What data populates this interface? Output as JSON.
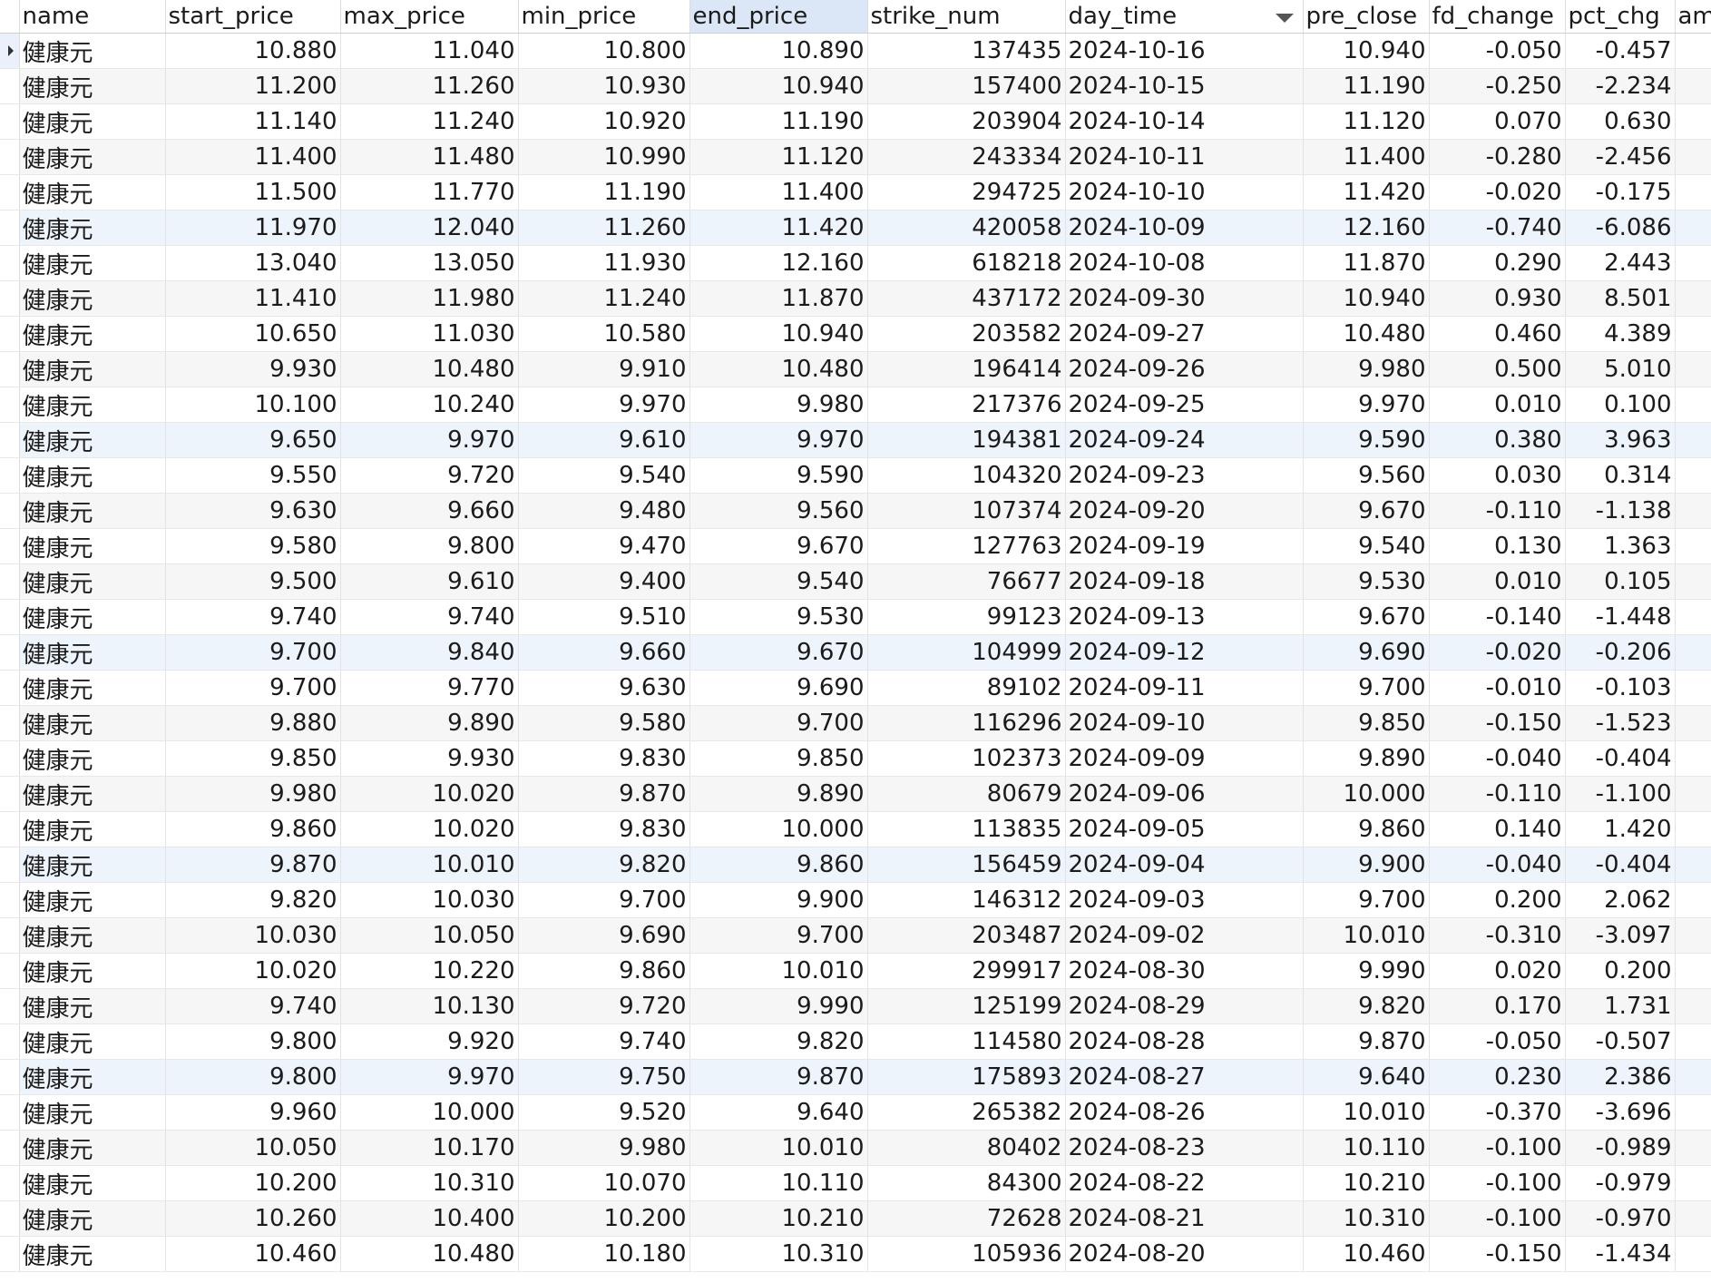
{
  "columns": [
    "name",
    "start_price",
    "max_price",
    "min_price",
    "end_price",
    "strike_num",
    "day_time",
    "pre_close",
    "fd_change",
    "pct_chg",
    "amo"
  ],
  "rows": [
    [
      "健康元",
      "10.880",
      "11.040",
      "10.800",
      "10.890",
      "137435",
      "2024-10-16",
      "10.940",
      "-0.050",
      "-0.457"
    ],
    [
      "健康元",
      "11.200",
      "11.260",
      "10.930",
      "10.940",
      "157400",
      "2024-10-15",
      "11.190",
      "-0.250",
      "-2.234"
    ],
    [
      "健康元",
      "11.140",
      "11.240",
      "10.920",
      "11.190",
      "203904",
      "2024-10-14",
      "11.120",
      "0.070",
      "0.630"
    ],
    [
      "健康元",
      "11.400",
      "11.480",
      "10.990",
      "11.120",
      "243334",
      "2024-10-11",
      "11.400",
      "-0.280",
      "-2.456"
    ],
    [
      "健康元",
      "11.500",
      "11.770",
      "11.190",
      "11.400",
      "294725",
      "2024-10-10",
      "11.420",
      "-0.020",
      "-0.175"
    ],
    [
      "健康元",
      "11.970",
      "12.040",
      "11.260",
      "11.420",
      "420058",
      "2024-10-09",
      "12.160",
      "-0.740",
      "-6.086"
    ],
    [
      "健康元",
      "13.040",
      "13.050",
      "11.930",
      "12.160",
      "618218",
      "2024-10-08",
      "11.870",
      "0.290",
      "2.443"
    ],
    [
      "健康元",
      "11.410",
      "11.980",
      "11.240",
      "11.870",
      "437172",
      "2024-09-30",
      "10.940",
      "0.930",
      "8.501"
    ],
    [
      "健康元",
      "10.650",
      "11.030",
      "10.580",
      "10.940",
      "203582",
      "2024-09-27",
      "10.480",
      "0.460",
      "4.389"
    ],
    [
      "健康元",
      "9.930",
      "10.480",
      "9.910",
      "10.480",
      "196414",
      "2024-09-26",
      "9.980",
      "0.500",
      "5.010"
    ],
    [
      "健康元",
      "10.100",
      "10.240",
      "9.970",
      "9.980",
      "217376",
      "2024-09-25",
      "9.970",
      "0.010",
      "0.100"
    ],
    [
      "健康元",
      "9.650",
      "9.970",
      "9.610",
      "9.970",
      "194381",
      "2024-09-24",
      "9.590",
      "0.380",
      "3.963"
    ],
    [
      "健康元",
      "9.550",
      "9.720",
      "9.540",
      "9.590",
      "104320",
      "2024-09-23",
      "9.560",
      "0.030",
      "0.314"
    ],
    [
      "健康元",
      "9.630",
      "9.660",
      "9.480",
      "9.560",
      "107374",
      "2024-09-20",
      "9.670",
      "-0.110",
      "-1.138"
    ],
    [
      "健康元",
      "9.580",
      "9.800",
      "9.470",
      "9.670",
      "127763",
      "2024-09-19",
      "9.540",
      "0.130",
      "1.363"
    ],
    [
      "健康元",
      "9.500",
      "9.610",
      "9.400",
      "9.540",
      "76677",
      "2024-09-18",
      "9.530",
      "0.010",
      "0.105"
    ],
    [
      "健康元",
      "9.740",
      "9.740",
      "9.510",
      "9.530",
      "99123",
      "2024-09-13",
      "9.670",
      "-0.140",
      "-1.448"
    ],
    [
      "健康元",
      "9.700",
      "9.840",
      "9.660",
      "9.670",
      "104999",
      "2024-09-12",
      "9.690",
      "-0.020",
      "-0.206"
    ],
    [
      "健康元",
      "9.700",
      "9.770",
      "9.630",
      "9.690",
      "89102",
      "2024-09-11",
      "9.700",
      "-0.010",
      "-0.103"
    ],
    [
      "健康元",
      "9.880",
      "9.890",
      "9.580",
      "9.700",
      "116296",
      "2024-09-10",
      "9.850",
      "-0.150",
      "-1.523"
    ],
    [
      "健康元",
      "9.850",
      "9.930",
      "9.830",
      "9.850",
      "102373",
      "2024-09-09",
      "9.890",
      "-0.040",
      "-0.404"
    ],
    [
      "健康元",
      "9.980",
      "10.020",
      "9.870",
      "9.890",
      "80679",
      "2024-09-06",
      "10.000",
      "-0.110",
      "-1.100"
    ],
    [
      "健康元",
      "9.860",
      "10.020",
      "9.830",
      "10.000",
      "113835",
      "2024-09-05",
      "9.860",
      "0.140",
      "1.420"
    ],
    [
      "健康元",
      "9.870",
      "10.010",
      "9.820",
      "9.860",
      "156459",
      "2024-09-04",
      "9.900",
      "-0.040",
      "-0.404"
    ],
    [
      "健康元",
      "9.820",
      "10.030",
      "9.700",
      "9.900",
      "146312",
      "2024-09-03",
      "9.700",
      "0.200",
      "2.062"
    ],
    [
      "健康元",
      "10.030",
      "10.050",
      "9.690",
      "9.700",
      "203487",
      "2024-09-02",
      "10.010",
      "-0.310",
      "-3.097"
    ],
    [
      "健康元",
      "10.020",
      "10.220",
      "9.860",
      "10.010",
      "299917",
      "2024-08-30",
      "9.990",
      "0.020",
      "0.200"
    ],
    [
      "健康元",
      "9.740",
      "10.130",
      "9.720",
      "9.990",
      "125199",
      "2024-08-29",
      "9.820",
      "0.170",
      "1.731"
    ],
    [
      "健康元",
      "9.800",
      "9.920",
      "9.740",
      "9.820",
      "114580",
      "2024-08-28",
      "9.870",
      "-0.050",
      "-0.507"
    ],
    [
      "健康元",
      "9.800",
      "9.970",
      "9.750",
      "9.870",
      "175893",
      "2024-08-27",
      "9.640",
      "0.230",
      "2.386"
    ],
    [
      "健康元",
      "9.960",
      "10.000",
      "9.520",
      "9.640",
      "265382",
      "2024-08-26",
      "10.010",
      "-0.370",
      "-3.696"
    ],
    [
      "健康元",
      "10.050",
      "10.170",
      "9.980",
      "10.010",
      "80402",
      "2024-08-23",
      "10.110",
      "-0.100",
      "-0.989"
    ],
    [
      "健康元",
      "10.200",
      "10.310",
      "10.070",
      "10.110",
      "84300",
      "2024-08-22",
      "10.210",
      "-0.100",
      "-0.979"
    ],
    [
      "健康元",
      "10.260",
      "10.400",
      "10.200",
      "10.210",
      "72628",
      "2024-08-21",
      "10.310",
      "-0.100",
      "-0.970"
    ],
    [
      "健康元",
      "10.460",
      "10.480",
      "10.180",
      "10.310",
      "105936",
      "2024-08-20",
      "10.460",
      "-0.150",
      "-1.434"
    ]
  ],
  "sorted_column": "day_time",
  "sort_direction": "descending",
  "selected_column": "end_price",
  "current_row": 0,
  "highlighted_rows": [
    5,
    11,
    17,
    23,
    29
  ]
}
